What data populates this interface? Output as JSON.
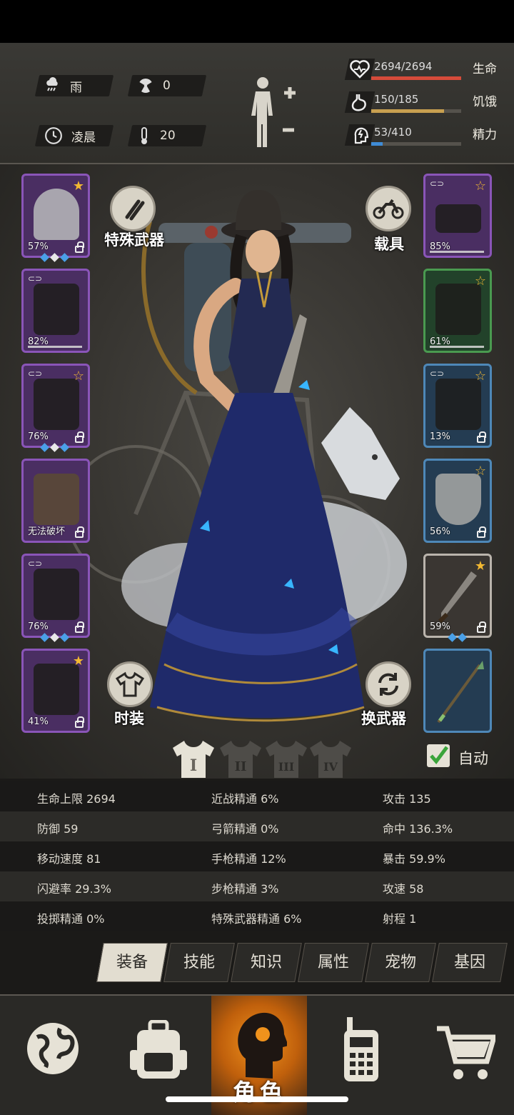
{
  "status": {
    "weather_icon": "rain-cloud-icon",
    "weather": "雨",
    "radiation_icon": "radiation-icon",
    "radiation": "0",
    "time_icon": "clock-icon",
    "time_of_day": "凌晨",
    "temperature_icon": "thermometer-icon",
    "temperature": "20"
  },
  "vitals": {
    "health": {
      "value": "2694/2694",
      "label": "生命",
      "fraction": 1.0,
      "color": "#d64b3a"
    },
    "hunger": {
      "value": "150/185",
      "label": "饥饿",
      "fraction": 0.81,
      "color": "#c8a050"
    },
    "energy": {
      "value": "53/410",
      "label": "精力",
      "fraction": 0.13,
      "color": "#3f8cd6"
    }
  },
  "equipment_left": [
    {
      "name": "helmet",
      "pct": "57%",
      "rarity": "purple",
      "star": true,
      "gems": 3
    },
    {
      "name": "shirt",
      "pct": "82%",
      "rarity": "purple",
      "star": false,
      "linked": true,
      "gems": 0
    },
    {
      "name": "jacket",
      "pct": "76%",
      "rarity": "purple",
      "star": true,
      "linked": true,
      "gems": 3
    },
    {
      "name": "backpack",
      "pct": "无法破坏",
      "rarity": "purple",
      "star": false,
      "gems": 0
    },
    {
      "name": "pants",
      "pct": "76%",
      "rarity": "purple",
      "star": false,
      "linked": true,
      "gems": 3
    },
    {
      "name": "boots",
      "pct": "41%",
      "rarity": "purple",
      "star": true,
      "gems": 0
    }
  ],
  "equipment_right": [
    {
      "name": "goggles",
      "pct": "85%",
      "rarity": "purple",
      "star": true,
      "linked": true
    },
    {
      "name": "mask",
      "pct": "61%",
      "rarity": "green",
      "star": true
    },
    {
      "name": "vest",
      "pct": "13%",
      "rarity": "blue",
      "star": true,
      "linked": true
    },
    {
      "name": "shield",
      "pct": "56%",
      "rarity": "blue",
      "star": true
    },
    {
      "name": "machete",
      "pct": "59%",
      "rarity": "grey",
      "star": true,
      "gems": 2
    },
    {
      "name": "spear",
      "pct": "",
      "rarity": "blue",
      "star": false
    }
  ],
  "buttons": {
    "special_weapon": "特殊武器",
    "vehicle": "载具",
    "fashion": "时装",
    "switch_weapon": "换武器",
    "auto": "自动"
  },
  "outfits": [
    "I",
    "II",
    "III",
    "IV"
  ],
  "stats": [
    [
      "生命上限 2694",
      "近战精通 6%",
      "攻击 135"
    ],
    [
      "防御 59",
      "弓箭精通 0%",
      "命中 136.3%"
    ],
    [
      "移动速度 81",
      "手枪精通 12%",
      "暴击 59.9%"
    ],
    [
      "闪避率 29.3%",
      "步枪精通 3%",
      "攻速 58"
    ],
    [
      "投掷精通 0%",
      "特殊武器精通 6%",
      "射程 1"
    ]
  ],
  "tabs": [
    "装备",
    "技能",
    "知识",
    "属性",
    "宠物",
    "基因"
  ],
  "nav": {
    "world_icon": "globe-icon",
    "inventory_icon": "backpack-icon",
    "character_label": "角色",
    "radio_icon": "walkie-talkie-icon",
    "shop_icon": "shopping-cart-icon"
  },
  "colors": {
    "rarity_purple": "#8a55b8",
    "rarity_green": "#4a9a50",
    "rarity_blue": "#4e88b8",
    "gem": "#4aa0e8",
    "star": "#f2b832"
  }
}
